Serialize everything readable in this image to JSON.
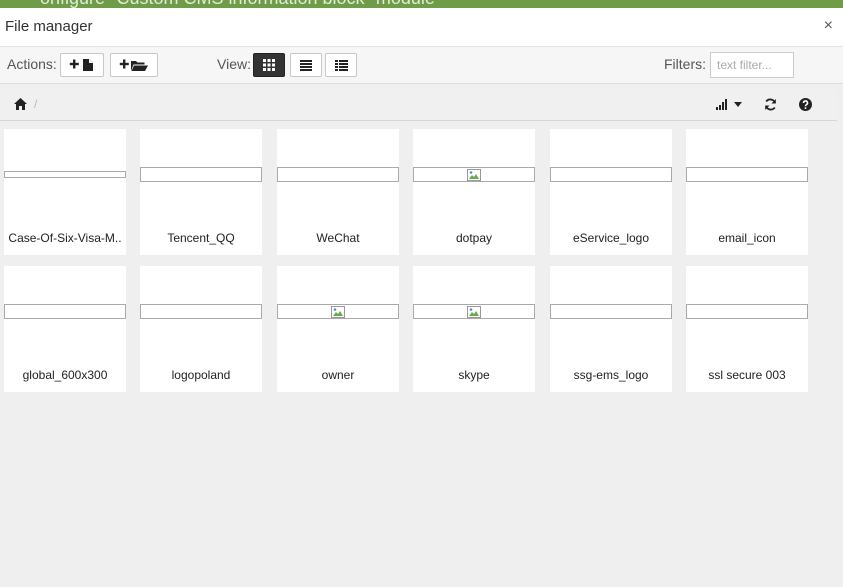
{
  "background_title": "onfigure \"Custom CMS information block\" module",
  "modal": {
    "title": "File manager",
    "close_label": "×"
  },
  "toolbar": {
    "actions_label": "Actions:",
    "view_label": "View:",
    "filters_label": "Filters:",
    "filter_placeholder": "text filter...",
    "active_view": "grid"
  },
  "breadcrumb": {
    "separator": "/"
  },
  "files": [
    {
      "name": "Case-Of-Six-Visa-M..",
      "image_loaded": false
    },
    {
      "name": "Tencent_QQ",
      "image_loaded": false
    },
    {
      "name": "WeChat",
      "image_loaded": false
    },
    {
      "name": "dotpay",
      "image_loaded": true
    },
    {
      "name": "eService_logo",
      "image_loaded": false
    },
    {
      "name": "email_icon",
      "image_loaded": false
    },
    {
      "name": "global_600x300",
      "image_loaded": false
    },
    {
      "name": "logopoland",
      "image_loaded": false
    },
    {
      "name": "owner",
      "image_loaded": true
    },
    {
      "name": "skype",
      "image_loaded": true
    },
    {
      "name": "ssg-ems_logo",
      "image_loaded": false
    },
    {
      "name": "ssl secure 003",
      "image_loaded": false
    }
  ],
  "colors": {
    "header_bar": "#6e9c47",
    "active_view_button": "#333333"
  }
}
